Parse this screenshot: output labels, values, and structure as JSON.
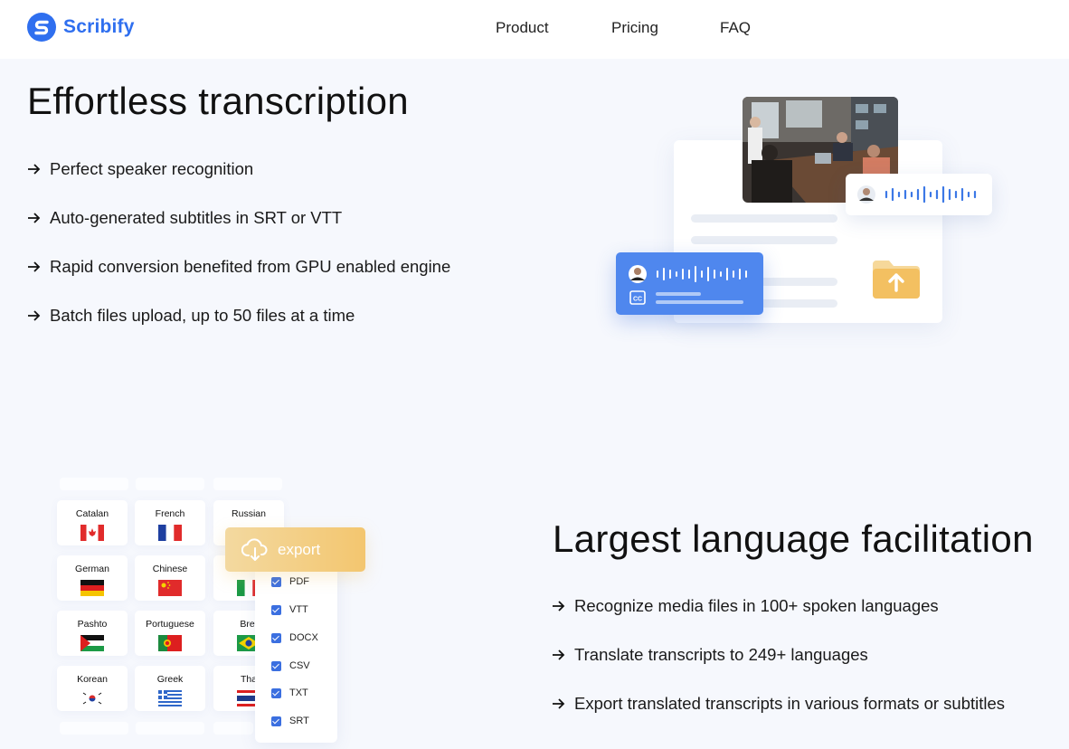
{
  "header": {
    "brand": "Scribify",
    "nav": [
      "Product",
      "Pricing",
      "FAQ"
    ]
  },
  "section1": {
    "title": "Effortless transcription",
    "features": [
      "Perfect speaker recognition",
      "Auto-generated subtitles in SRT or VTT",
      "Rapid conversion benefited from GPU enabled engine",
      "Batch files upload, up to 50 files at a time"
    ]
  },
  "section2": {
    "title": "Largest language facilitation",
    "features": [
      "Recognize media files in 100+ spoken languages",
      "Translate transcripts to 249+ languages",
      "Export translated transcripts in various formats or subtitles"
    ],
    "languages": [
      "Catalan",
      "French",
      "Russian",
      "German",
      "Chinese",
      "Pashto",
      "Portuguese",
      "Bret",
      "Korean",
      "Greek",
      "Tha"
    ],
    "export_label": "export",
    "formats": [
      "PDF",
      "VTT",
      "DOCX",
      "CSV",
      "TXT",
      "SRT"
    ]
  },
  "colors": {
    "brand": "#2f6fef",
    "accent_blue": "#4f87ee",
    "export": "#f3c66f",
    "background": "#f6f8fd"
  },
  "icons": [
    "logo-icon",
    "arrow-right-icon",
    "cloud-download-icon",
    "checkbox-icon",
    "upload-folder-icon",
    "closed-caption-icon",
    "audio-wave-icon"
  ]
}
